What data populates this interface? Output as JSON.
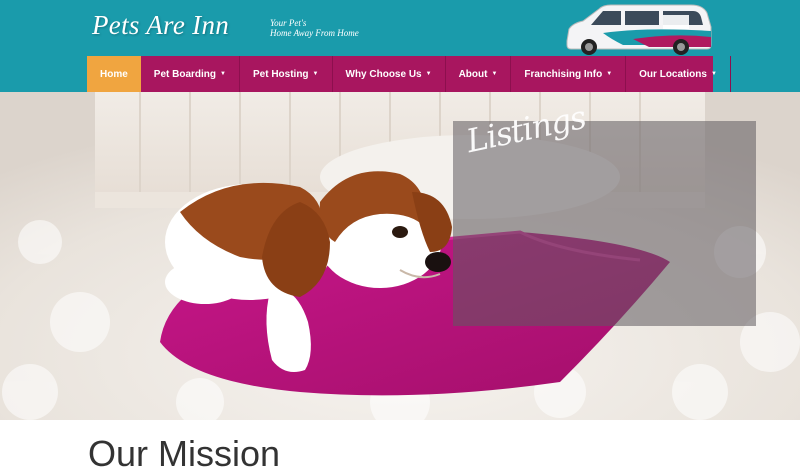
{
  "header": {
    "logo_text": "Pets Are Inn",
    "tagline_line1": "Your Pet's",
    "tagline_line2": "Home Away From Home",
    "van_image": "branded-minivan"
  },
  "nav": {
    "items": [
      {
        "label": "Home",
        "has_dropdown": false,
        "active": true
      },
      {
        "label": "Pet Boarding",
        "has_dropdown": true
      },
      {
        "label": "Pet Hosting",
        "has_dropdown": true
      },
      {
        "label": "Why Choose Us",
        "has_dropdown": true
      },
      {
        "label": "About",
        "has_dropdown": true
      },
      {
        "label": "Franchising Info",
        "has_dropdown": true
      },
      {
        "label": "Our Locations",
        "has_dropdown": true
      }
    ],
    "caret_glyph": "▼"
  },
  "hero": {
    "image": "cavalier-king-charles-spaniel-on-magenta-pillow",
    "overlay_text": "Listings"
  },
  "main": {
    "heading": "Our Mission"
  },
  "colors": {
    "header_bg": "#1a9bab",
    "nav_bg": "#a8165f",
    "nav_active": "#f0a540",
    "pillow": "#c4157f"
  }
}
